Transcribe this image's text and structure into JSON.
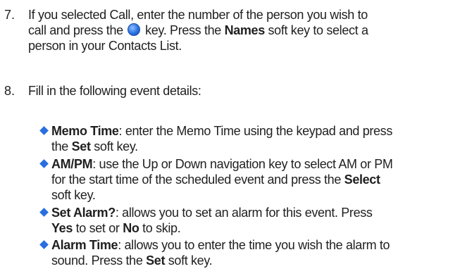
{
  "step7": {
    "number": "7.",
    "l1": "If you selected Call, enter the number of the person you wish to",
    "l2a": "call and press the",
    "l2b": "key. Press the",
    "l2bold": "Names",
    "l2c": "soft key to select a",
    "l3": "person in your Contacts List.",
    "icon": "blue-round-key-icon"
  },
  "step8": {
    "number": "8.",
    "text": "Fill in the following event details:"
  },
  "bullets": [
    {
      "term": "Memo Time",
      "t1": ": enter the Memo Time using the keypad and press",
      "t2a": "the",
      "t2bold": "Set",
      "t2b": "soft key."
    },
    {
      "term": "AM/PM",
      "t1": ": use the Up or Down navigation key to select AM or PM",
      "t2a": "for the start time of the scheduled event and press the",
      "t2bold": "Select",
      "t3": "soft key."
    },
    {
      "term": "Set Alarm?",
      "t1": ": allows you to set an alarm for this event. Press",
      "t2bold1": "Yes",
      "t2a": "to set or",
      "t2bold2": "No",
      "t2b": "to skip."
    },
    {
      "term": "Alarm Time",
      "t1": ": allows you to enter the time you wish the alarm to",
      "t2a": "sound. Press the",
      "t2bold": "Set",
      "t2b": "soft key."
    }
  ],
  "colors": {
    "text": "#1f1f1f",
    "accent": "#2a6fe0"
  }
}
